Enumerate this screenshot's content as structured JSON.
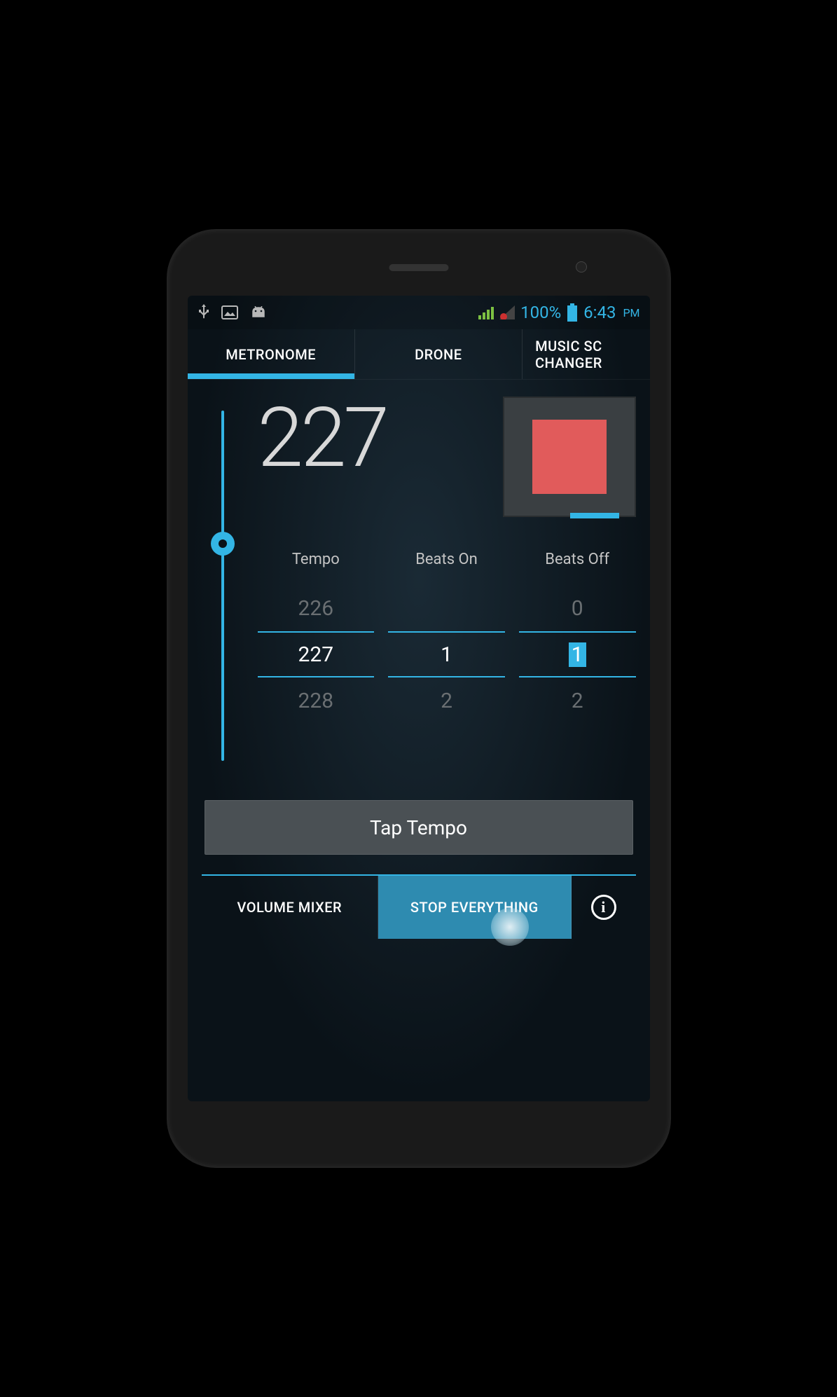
{
  "status": {
    "battery": "100%",
    "time": "6:43",
    "ampm": "PM"
  },
  "tabs": [
    {
      "label": "METRONOME",
      "active": true
    },
    {
      "label": "DRONE",
      "active": false
    },
    {
      "label": "MUSIC SC\nCHANGER",
      "active": false,
      "partial": true
    }
  ],
  "bpm": "227",
  "pickers": {
    "tempo": {
      "label": "Tempo",
      "prev": "226",
      "current": "227",
      "next": "228"
    },
    "beatsOn": {
      "label": "Beats On",
      "prev": "",
      "current": "1",
      "next": "2"
    },
    "beatsOff": {
      "label": "Beats Off",
      "prev": "0",
      "current": "1",
      "next": "2",
      "highlighted": true
    }
  },
  "tapTempo": "Tap Tempo",
  "bottom": {
    "volumeMixer": "VOLUME MIXER",
    "stopEverything": "STOP EVERYTHING"
  }
}
